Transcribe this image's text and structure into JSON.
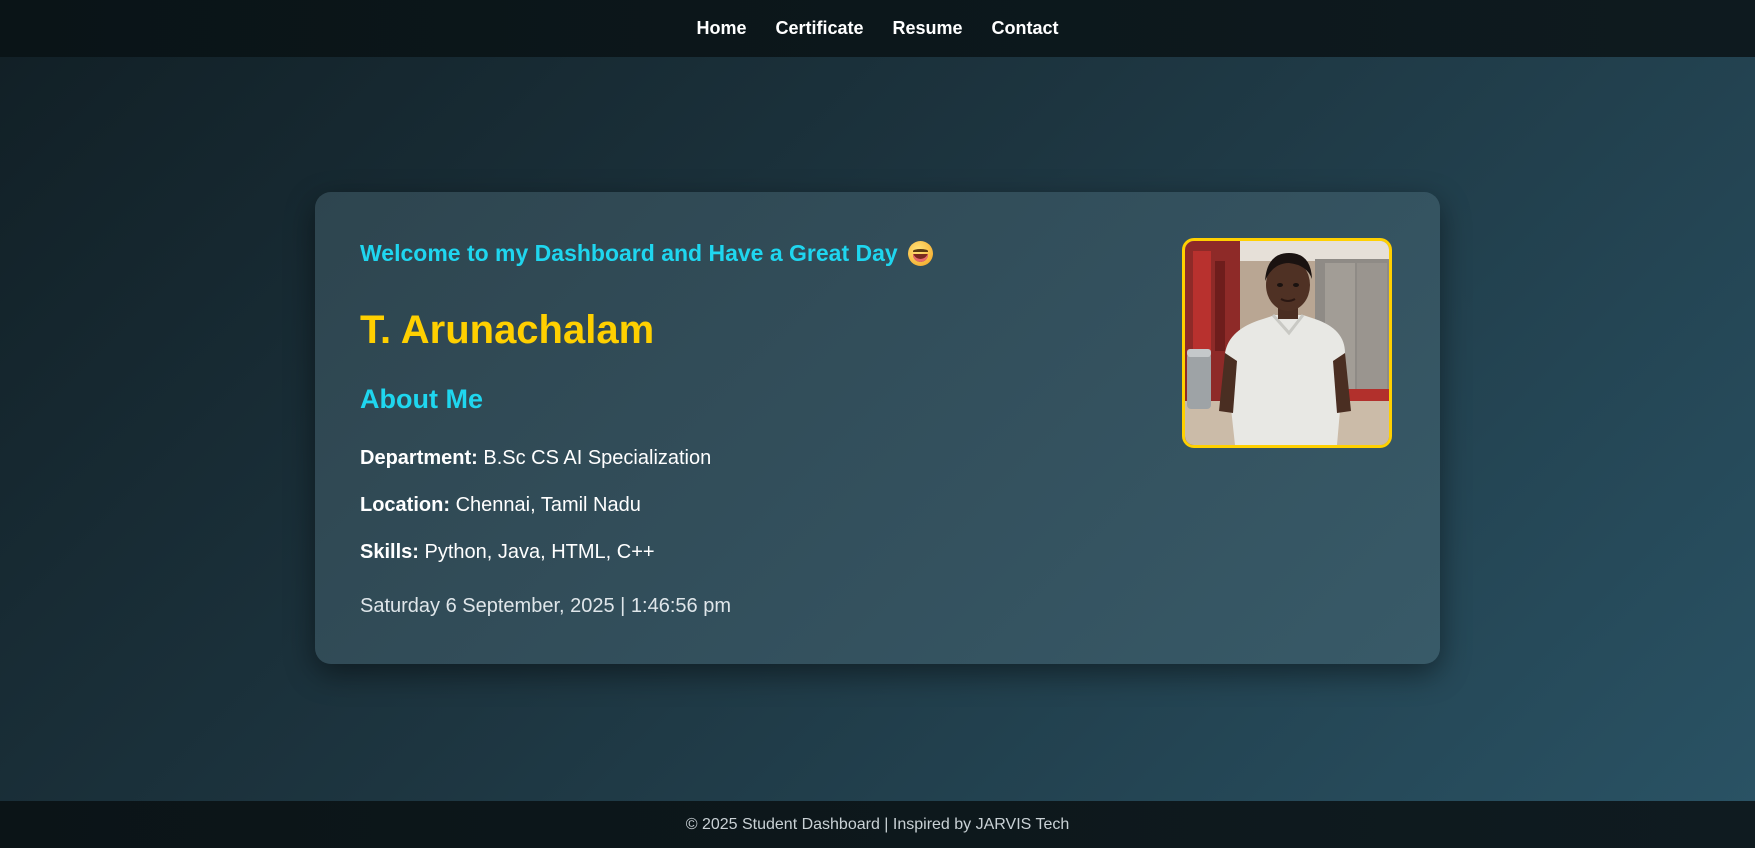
{
  "nav": {
    "items": [
      {
        "label": "Home"
      },
      {
        "label": "Certificate"
      },
      {
        "label": "Resume"
      },
      {
        "label": "Contact"
      }
    ]
  },
  "card": {
    "welcome": "Welcome to my Dashboard and Have a Great Day",
    "welcome_emoji_icon": "grinning-face-icon",
    "name": "T. Arunachalam",
    "about_heading": "About Me",
    "details": [
      {
        "label": "Department:",
        "value": "B.Sc CS AI Specialization"
      },
      {
        "label": "Location:",
        "value": "Chennai, Tamil Nadu"
      },
      {
        "label": "Skills:",
        "value": "Python, Java, HTML, C++"
      }
    ],
    "datetime": "Saturday 6 September, 2025 | 1:46:56 pm",
    "photo_icon": "profile-photo"
  },
  "footer": {
    "text": "© 2025 Student Dashboard | Inspired by JARVIS Tech"
  },
  "colors": {
    "accent_cyan": "#1fd6ef",
    "accent_yellow": "#ffd000",
    "nav_bg": "#0a1417",
    "card_bg": "#33505d"
  }
}
